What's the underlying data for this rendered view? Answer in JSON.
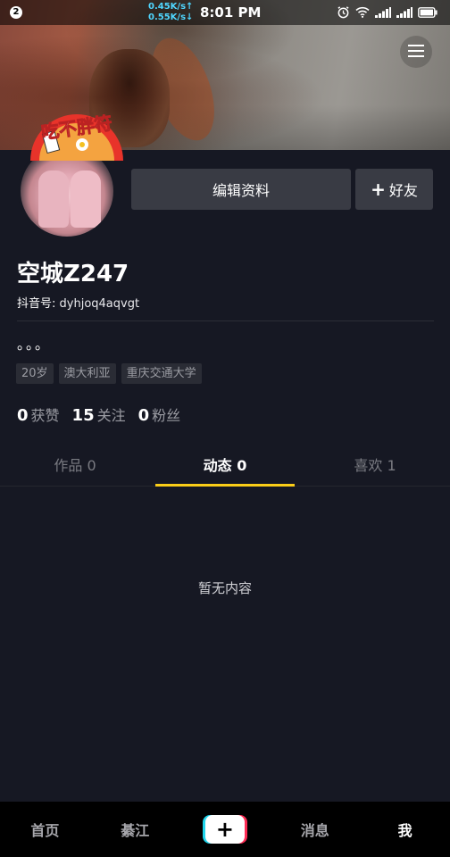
{
  "status_bar": {
    "notification_count": "2",
    "upload_speed": "0.45K/s↑",
    "download_speed": "0.55K/s↓",
    "time": "8:01 PM",
    "icons": [
      "alarm-icon",
      "wifi-icon",
      "signal-icon",
      "signal-icon-2",
      "battery-icon"
    ]
  },
  "header": {
    "menu_icon": "menu-icon",
    "avatar_sticker_text": "吃不胖符"
  },
  "profile": {
    "edit_button": "编辑资料",
    "add_friend_button": "好友",
    "add_friend_icon": "plus-icon",
    "name": "空城Z247",
    "id_label": "抖音号:",
    "id_value": "dyhjoq4aqvgt",
    "bio": "。。。",
    "tags": [
      "20岁",
      "澳大利亚",
      "重庆交通大学"
    ],
    "stats": [
      {
        "value": "0",
        "label": "获赞"
      },
      {
        "value": "15",
        "label": "关注"
      },
      {
        "value": "0",
        "label": "粉丝"
      }
    ]
  },
  "tabs": [
    {
      "label": "作品 0",
      "active": false
    },
    {
      "label": "动态 0",
      "active": true
    },
    {
      "label": "喜欢 1",
      "active": false
    }
  ],
  "empty_state": "暂无内容",
  "bottom_nav": {
    "home": "首页",
    "city": "綦江",
    "create": "+",
    "messages": "消息",
    "me": "我"
  },
  "colors": {
    "background": "#161823",
    "tab_indicator": "#facd18",
    "button_bg": "#393b44",
    "create_cyan": "#20d5ec",
    "create_red": "#fe2c55"
  }
}
